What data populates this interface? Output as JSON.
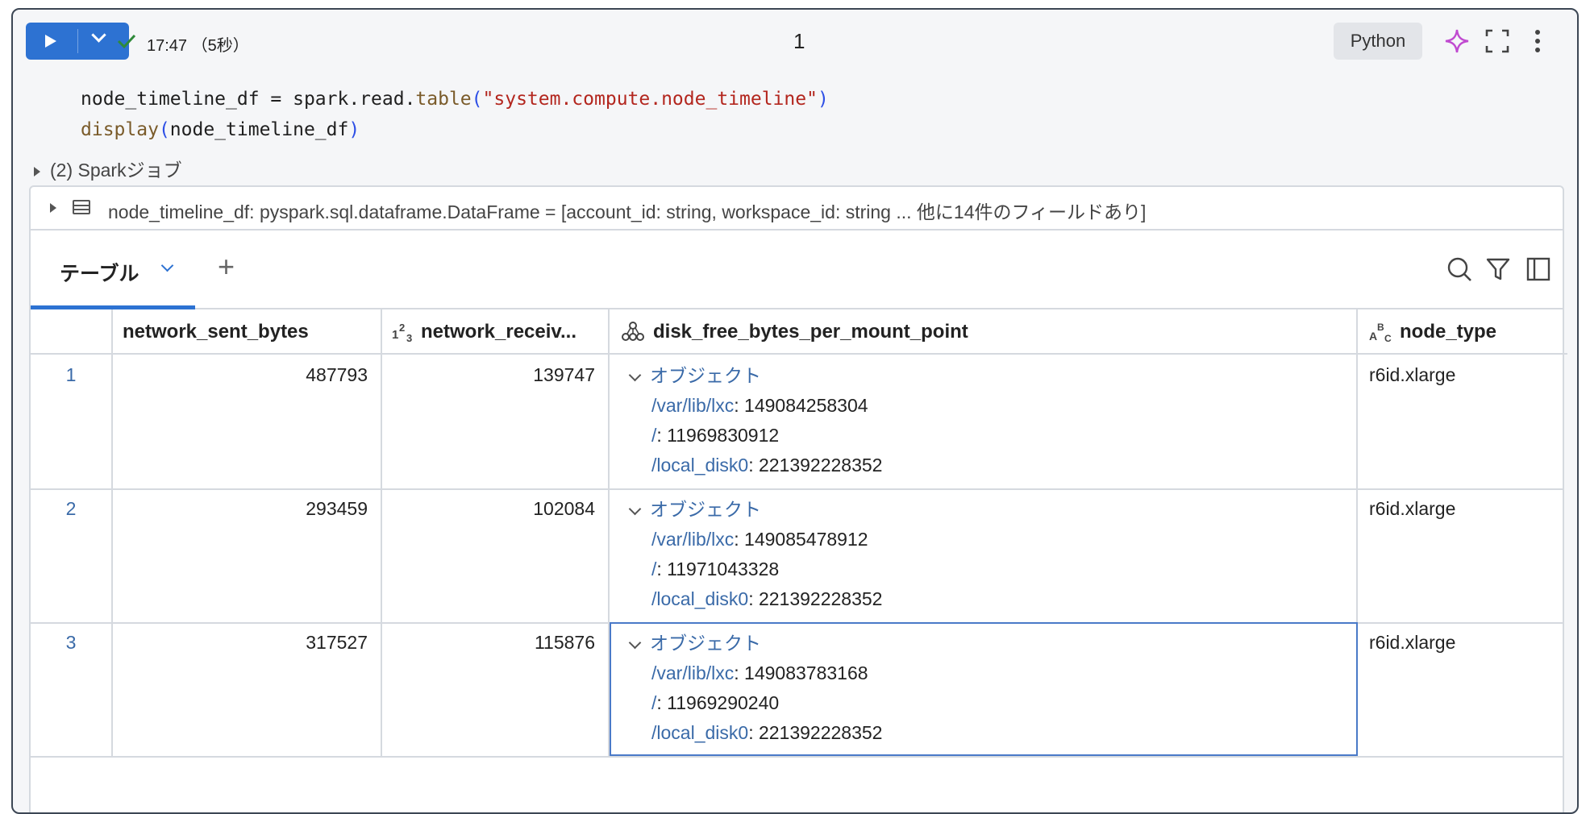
{
  "toolbar": {
    "status_time": "17:47 （5秒）",
    "cell_number": "1",
    "language": "Python"
  },
  "code": {
    "line1": {
      "var": "node_timeline_df = spark.read.",
      "fn": "table",
      "open": "(",
      "str": "\"system.compute.node_timeline\"",
      "close": ")"
    },
    "line2": {
      "fn": "display",
      "open": "(",
      "arg": "node_timeline_df",
      "close": ")"
    }
  },
  "jobs_label": "(2) Sparkジョブ",
  "schema_text": "node_timeline_df:  pyspark.sql.dataframe.DataFrame = [account_id: string, workspace_id: string ... 他に14件のフィールドあり]",
  "tabs": {
    "active_label": "テーブル",
    "add": "+"
  },
  "columns": [
    {
      "label": "network_sent_bytes"
    },
    {
      "label": "network_receiv..."
    },
    {
      "label": "disk_free_bytes_per_mount_point"
    },
    {
      "label": "node_type"
    }
  ],
  "rows": [
    {
      "n": "1",
      "sent": "487793",
      "recv": "139747",
      "obj_label": "オブジェクト",
      "k1": "/var/lib/lxc",
      "v1": ": 149084258304",
      "k2": "/",
      "v2": ": 11969830912",
      "k3": "/local_disk0",
      "v3": ": 221392228352",
      "node_type": "r6id.xlarge"
    },
    {
      "n": "2",
      "sent": "293459",
      "recv": "102084",
      "obj_label": "オブジェクト",
      "k1": "/var/lib/lxc",
      "v1": ": 149085478912",
      "k2": "/",
      "v2": ": 11971043328",
      "k3": "/local_disk0",
      "v3": ": 221392228352",
      "node_type": "r6id.xlarge"
    },
    {
      "n": "3",
      "sent": "317527",
      "recv": "115876",
      "obj_label": "オブジェクト",
      "k1": "/var/lib/lxc",
      "v1": ": 149083783168",
      "k2": "/",
      "v2": ": 11969290240",
      "k3": "/local_disk0",
      "v3": ": 221392228352",
      "node_type": "r6id.xlarge"
    }
  ],
  "colors": {
    "accent": "#2d72d2",
    "link": "#3a6aa8"
  }
}
